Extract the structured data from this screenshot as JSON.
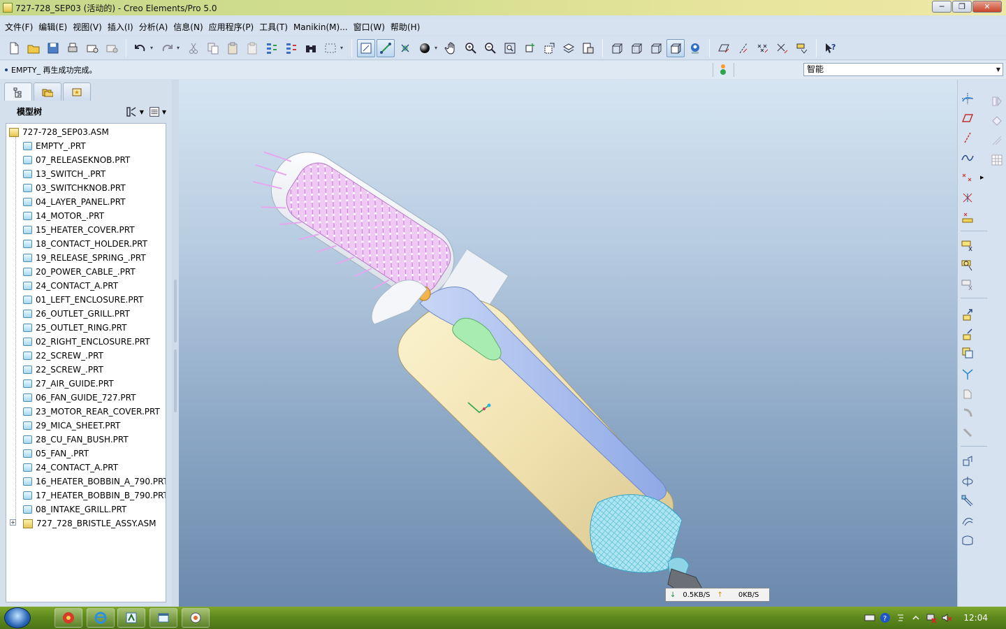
{
  "window": {
    "title": "727-728_SEP03 (活动的) - Creo Elements/Pro 5.0",
    "controls": [
      "minimize",
      "maximize",
      "close"
    ]
  },
  "menubar": {
    "items": [
      "文件(F)",
      "编辑(E)",
      "视图(V)",
      "插入(I)",
      "分析(A)",
      "信息(N)",
      "应用程序(P)",
      "工具(T)",
      "Manikin(M)...",
      "窗口(W)",
      "帮助(H)"
    ]
  },
  "messages": {
    "status": "EMPTY_ 再生成功完成。",
    "filter_value": "智能"
  },
  "model_tree": {
    "title": "模型树",
    "root": "727-728_SEP03.ASM",
    "items": [
      "EMPTY_.PRT",
      "07_RELEASEKNOB.PRT",
      "13_SWITCH_.PRT",
      "03_SWITCHKNOB.PRT",
      "04_LAYER_PANEL.PRT",
      "14_MOTOR_.PRT",
      "15_HEATER_COVER.PRT",
      "18_CONTACT_HOLDER.PRT",
      "19_RELEASE_SPRING_.PRT",
      "20_POWER_CABLE_.PRT",
      "24_CONTACT_A.PRT",
      "01_LEFT_ENCLOSURE.PRT",
      "26_OUTLET_GRILL.PRT",
      "25_OUTLET_RING.PRT",
      "02_RIGHT_ENCLOSURE.PRT",
      "22_SCREW_.PRT",
      "22_SCREW_.PRT",
      "27_AIR_GUIDE.PRT",
      "06_FAN_GUIDE_727.PRT",
      "23_MOTOR_REAR_COVER.PRT",
      "29_MICA_SHEET.PRT",
      "28_CU_FAN_BUSH.PRT",
      "05_FAN_.PRT",
      "24_CONTACT_A.PRT",
      "16_HEATER_BOBBIN_A_790.PRT",
      "17_HEATER_BOBBIN_B_790.PRT",
      "08_INTAKE_GRILL.PRT"
    ],
    "subassembly": "727_728_BRISTLE_ASSY.ASM"
  },
  "net_monitor": {
    "download": "0.5KB/S",
    "upload": "0KB/S"
  },
  "taskbar": {
    "clock": "12:04"
  },
  "colors": {
    "viewport_top": "#d6e5f1",
    "viewport_bottom": "#6b89ad",
    "handle_body": "#f3e6b8",
    "handle_top": "#9bb6ee",
    "bristle": "#e3a9ee",
    "grill": "#7fd3e6",
    "switch": "#a8ecb0",
    "taskbar": "#5f8a1e"
  }
}
